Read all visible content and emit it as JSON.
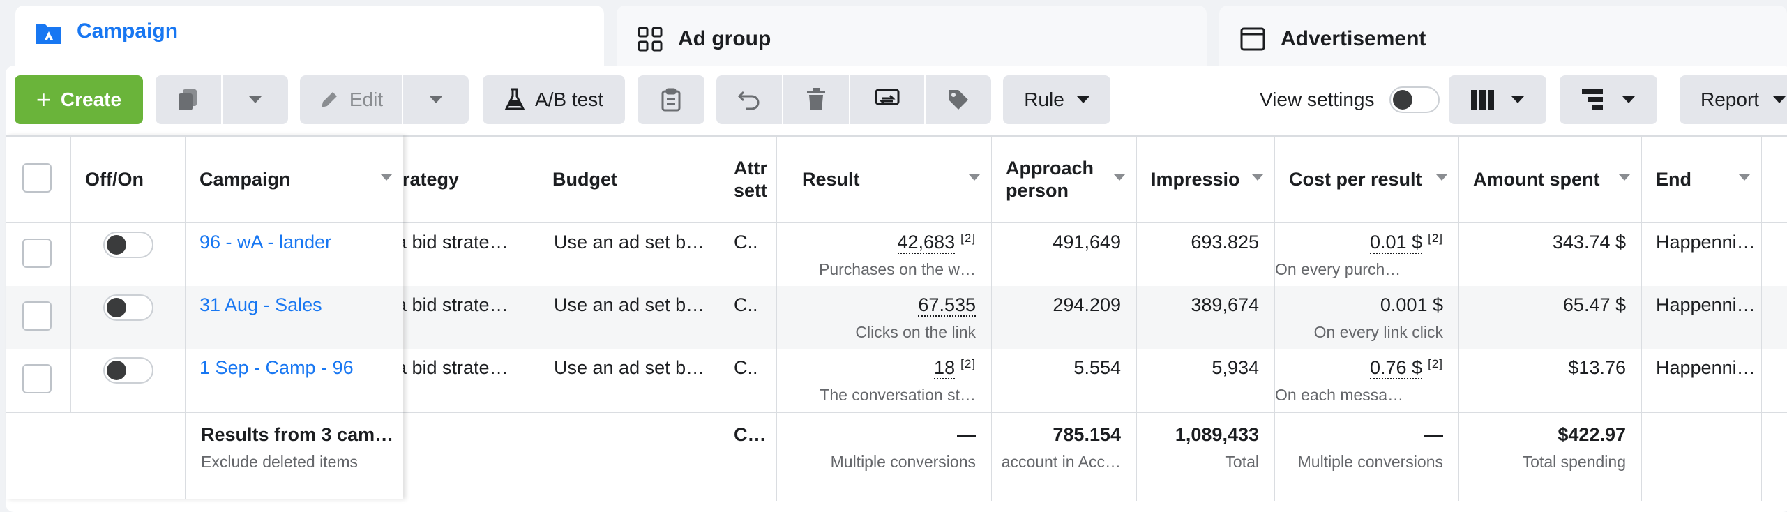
{
  "tabs": [
    {
      "label": "Campaign",
      "icon": "folder-icon",
      "active": true
    },
    {
      "label": "Ad group",
      "icon": "grid-icon",
      "active": false
    },
    {
      "label": "Advertisement",
      "icon": "ad-window-icon",
      "active": false
    }
  ],
  "toolbar": {
    "create": "Create",
    "edit": "Edit",
    "ab_test": "A/B test",
    "rule": "Rule",
    "view_settings": "View settings",
    "report": "Report"
  },
  "columns": {
    "off_on": "Off/On",
    "campaign": "Campaign",
    "strategy": "trategy",
    "budget": "Budget",
    "attr": "Attr sett",
    "result": "Result",
    "approach": "Approach person",
    "impressions": "Impressio",
    "cost": "Cost per result",
    "amount": "Amount spent",
    "end": "End"
  },
  "rows": [
    {
      "campaign": "96 - wA - lander",
      "strategy": "a bid strate…",
      "budget": "Use an ad set b…",
      "attr": "C..",
      "result": "42,683",
      "result_note": "[2]",
      "result_sub": "Purchases on the w…",
      "approach": "491,649",
      "impressions": "693.825",
      "cost": "0.01 $",
      "cost_note": "[2]",
      "cost_sub": "On every purch…",
      "amount": "343.74 $",
      "end": "Happenni…"
    },
    {
      "campaign": "31 Aug - Sales",
      "strategy": "a bid strate…",
      "budget": "Use an ad set b…",
      "attr": "C..",
      "result": "67.535",
      "result_note": "",
      "result_sub": "Clicks on the link",
      "approach": "294.209",
      "impressions": "389,674",
      "cost": "0.001 $",
      "cost_note": "",
      "cost_sub": "On every link click",
      "amount": "65.47 $",
      "end": "Happenni…"
    },
    {
      "campaign": "1 Sep - Camp - 96",
      "strategy": "a bid strate…",
      "budget": "Use an ad set b…",
      "attr": "C..",
      "result": "18",
      "result_note": "[2]",
      "result_sub": "The conversation st…",
      "approach": "5.554",
      "impressions": "5,934",
      "cost": "0.76 $",
      "cost_note": "[2]",
      "cost_sub": "On each messa…",
      "amount": "$13.76",
      "end": "Happenni…"
    }
  ],
  "totals": {
    "label": "Results from 3 cam…",
    "sub": "Exclude deleted items",
    "attr": "C…",
    "result": "—",
    "result_sub": "Multiple conversions",
    "approach": "785.154",
    "approach_sub": "account in Acc…",
    "impressions": "1,089,433",
    "impressions_sub": "Total",
    "cost": "—",
    "cost_sub": "Multiple conversions",
    "amount": "$422.97",
    "amount_sub": "Total spending"
  },
  "colors": {
    "accent": "#1877f2",
    "create_green": "#6ab43a"
  }
}
